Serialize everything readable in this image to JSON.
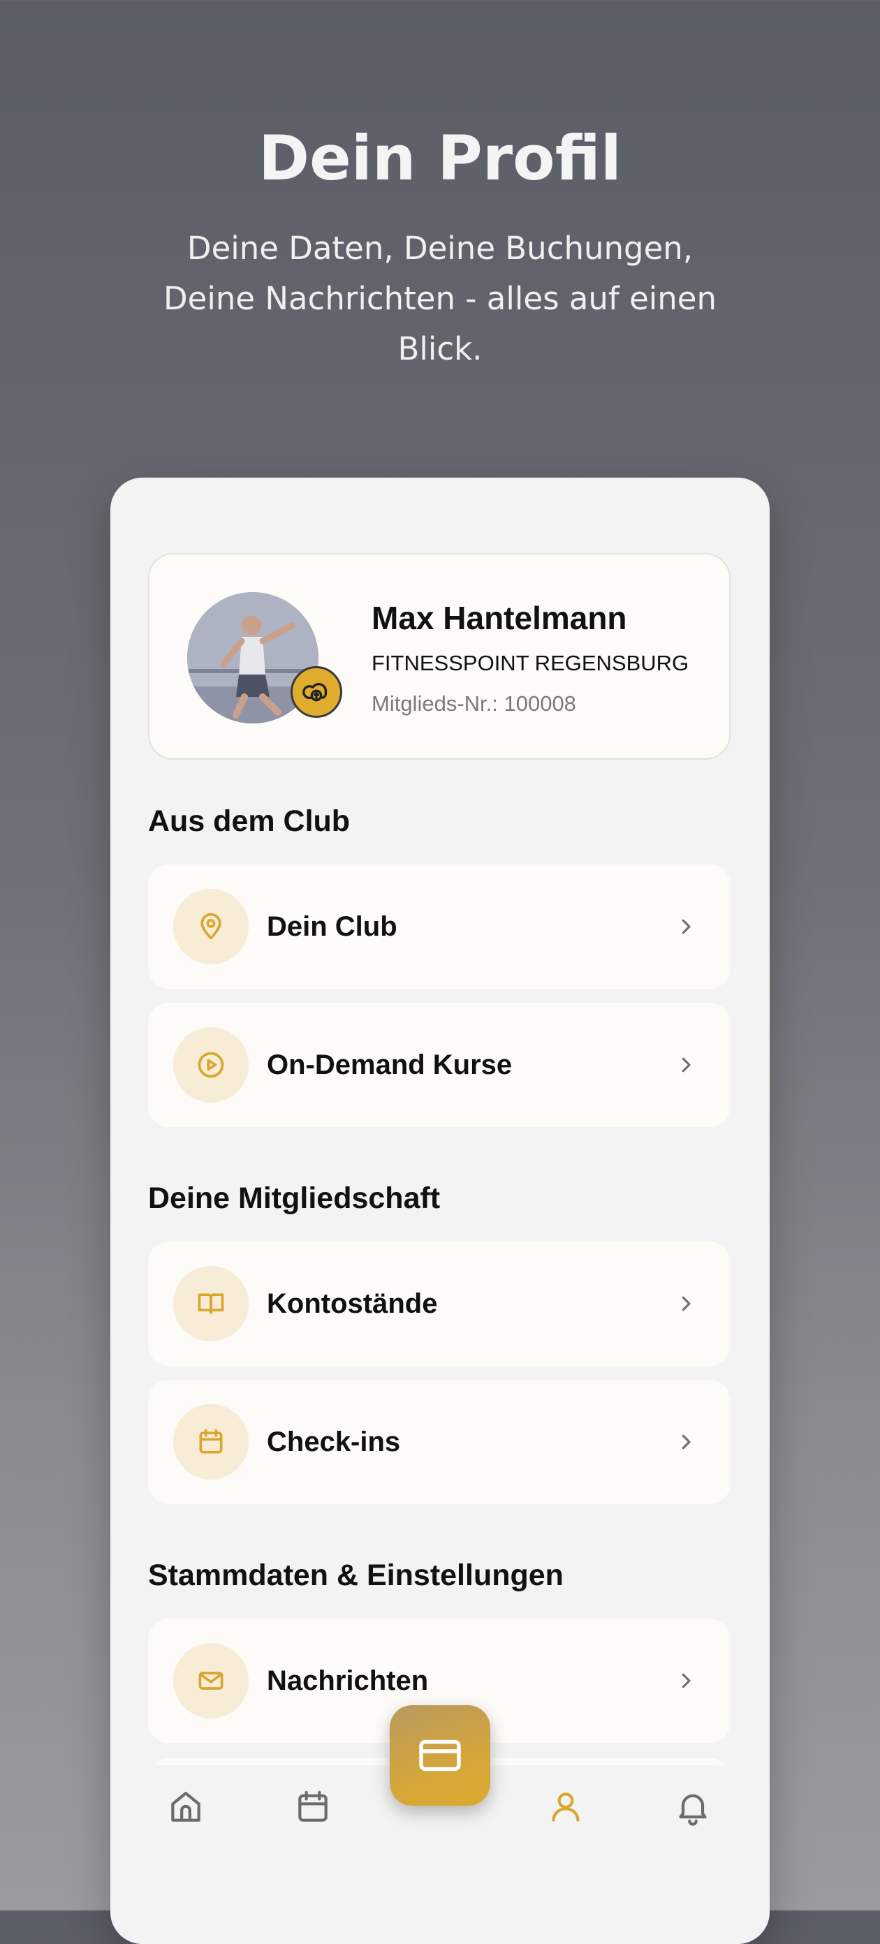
{
  "hero": {
    "title": "Dein Profil",
    "subtitle": "Deine Daten, Deine Buchungen, Deine Nachrichten - alles auf einen Blick."
  },
  "profile": {
    "name": "Max Hantelmann",
    "club": "FITNESSPOINT REGENSBURG",
    "member_number": "Mitglieds-Nr.: 100008",
    "avatar_icon": "user-photo",
    "upload_icon": "cloud-upload-icon"
  },
  "sections": [
    {
      "title": "Aus dem Club",
      "items": [
        {
          "label": "Dein Club",
          "icon": "location-pin-icon"
        },
        {
          "label": "On-Demand Kurse",
          "icon": "play-circle-icon"
        }
      ]
    },
    {
      "title": "Deine Mitgliedschaft",
      "items": [
        {
          "label": "Kontostände",
          "icon": "book-open-icon"
        },
        {
          "label": "Check-ins",
          "icon": "calendar-icon"
        }
      ]
    },
    {
      "title": "Stammdaten & Einstellungen",
      "items": [
        {
          "label": "Nachrichten",
          "icon": "mail-icon"
        }
      ]
    }
  ],
  "tabbar": {
    "items": [
      "home-icon",
      "calendar-icon",
      "card-icon",
      "user-icon",
      "bell-icon"
    ],
    "active": "user-icon"
  },
  "colors": {
    "accent": "#d9a62e",
    "accent_soft": "#f7ecd6",
    "card_bg": "#fcfbf7",
    "screen_bg": "#f3f3f4"
  }
}
